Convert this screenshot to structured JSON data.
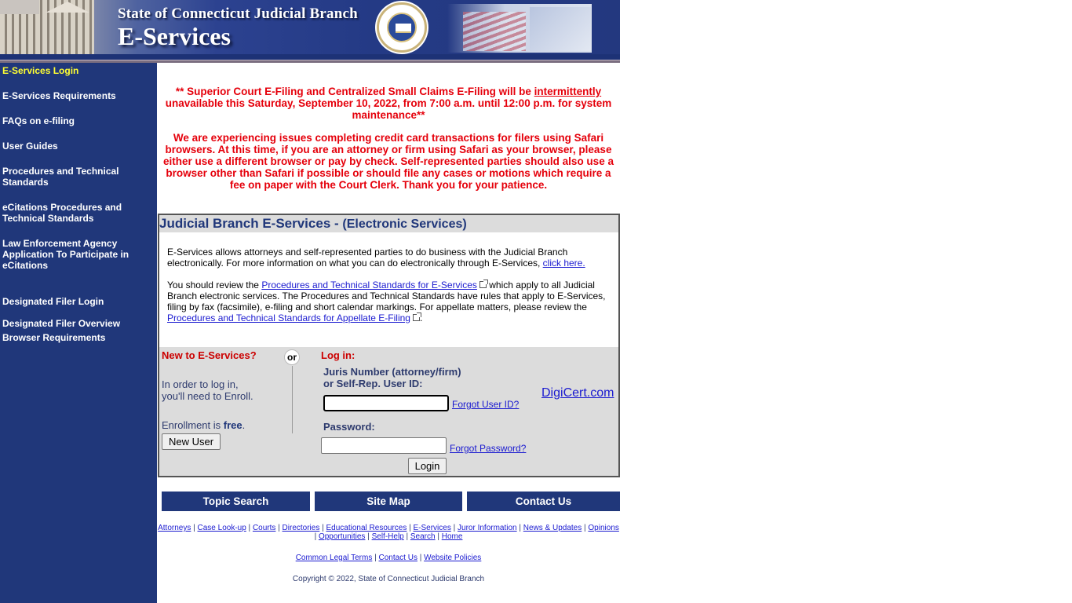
{
  "header": {
    "title": "State of Connecticut Judicial Branch",
    "subtitle": "E-Services"
  },
  "sidebar": {
    "items": [
      {
        "label": "E-Services Login",
        "active": true
      },
      {
        "label": "E-Services Requirements"
      },
      {
        "label": "FAQs on e-filing"
      },
      {
        "label": "User Guides"
      },
      {
        "label": "Procedures and Technical Standards"
      },
      {
        "label": "eCitations Procedures and Technical Standards"
      },
      {
        "label": "Law Enforcement Agency Application To Participate in eCitations"
      },
      {
        "label": "Designated Filer Login"
      },
      {
        "label": "Designated Filer Overview"
      },
      {
        "label": "Browser Requirements"
      }
    ]
  },
  "alerts": {
    "maintenance_pre": "** Superior Court E-Filing and Centralized Small Claims E-Filing will be ",
    "maintenance_emph": "intermittently",
    "maintenance_post": " unavailable this Saturday, September 10, 2022, from 7:00 a.m. until 12:00 p.m. for system maintenance**",
    "safari": "We are experiencing issues completing credit card transactions for filers using Safari browsers. At this time, if you are an attorney or firm using Safari as your browser, please either use a different browser or pay by check. Self-represented parties should also use a browser other than Safari if possible or should file any cases or motions which require a fee on paper with the Court Clerk. Thank you for your patience."
  },
  "services": {
    "heading": "Judicial Branch E-Services - ",
    "heading_sub": "(Electronic Services)",
    "para1_text": "E-Services allows attorneys and self-represented parties to do business with the Judicial Branch electronically. For more information on what you can do electronically through E-Services, ",
    "para1_link": "click here.",
    "para2_pre": "You should review the ",
    "para2_link1": "Procedures and Technical Standards for E-Services",
    "para2_mid": " which apply to all Judicial Branch electronic services. The Procedures and Technical Standards have rules that apply to E-Services, filing by fax (facsimile), e-filing and short calendar markings. For appellate matters, please review the ",
    "para2_link2": "Procedures and Technical Standards for Appellate E-Filing",
    "para2_end": "."
  },
  "enroll": {
    "heading": "New to E-Services?",
    "line1": "In order to log in,",
    "line2": "you'll need to Enroll.",
    "free_pre": "Enrollment is ",
    "free_word": "free",
    "free_post": ".",
    "button": "New User",
    "or": "or"
  },
  "login": {
    "heading": "Log in:",
    "juris_label_1": "Juris Number (attorney/firm)",
    "juris_label_2": "or Self-Rep. User ID:",
    "juris_value": "",
    "forgot_user": "Forgot User ID?",
    "password_label": "Password:",
    "password_value": "",
    "forgot_password": "Forgot Password?",
    "button": "Login",
    "digicert": "DigiCert.com"
  },
  "bottom_nav": [
    "Topic Search",
    "Site Map",
    "Contact Us"
  ],
  "footer": {
    "links_row1": [
      "Attorneys",
      "Case Look-up",
      "Courts",
      "Directories",
      "Educational Resources",
      "E-Services",
      "Juror Information",
      "News & Updates",
      "Opinions"
    ],
    "links_row2": [
      "Opportunities",
      "Self-Help",
      "Search",
      "Home"
    ],
    "links_row3": [
      "Common Legal Terms",
      "Contact Us",
      "Website Policies"
    ],
    "copyright": "Copyright © 2022, State of Connecticut Judicial Branch"
  },
  "colors": {
    "navy": "#20377a",
    "alert_red": "#e5000b",
    "active_nav": "#ffff33",
    "link": "#1a1ad0"
  }
}
